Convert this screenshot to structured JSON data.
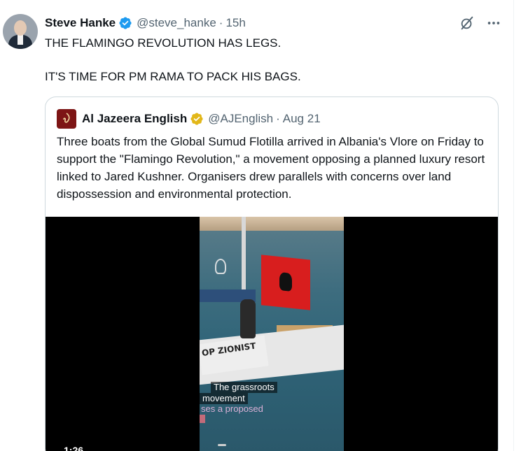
{
  "post": {
    "author_name": "Steve Hanke",
    "author_handle": "@steve_hanke",
    "separator": "·",
    "time": "15h",
    "text": "THE FLAMINGO REVOLUTION HAS LEGS.\n\nIT'S TIME FOR PM RAMA TO PACK HIS BAGS.",
    "more_icon": "more-horizontal-icon",
    "grok_icon": "grok-icon",
    "verified_color": "#1d9bf0"
  },
  "quote": {
    "author_name": "Al Jazeera English",
    "author_handle": "@AJEnglish",
    "separator": "·",
    "date": "Aug 21",
    "verified_color": "#e2b719",
    "text": "Three boats from the Global Sumud Flotilla arrived in Albania's Vlore on Friday to support the \"Flamingo Revolution,\" a movement opposing a planned luxury resort linked to Jared Kushner. Organisers drew parallels with concerns over land dispossession and environmental protection.",
    "video": {
      "duration": "1:26",
      "caption_lines": [
        "The grassroots",
        "movement",
        "ses a proposed"
      ],
      "banner_text": "OP ZIONIST"
    }
  }
}
